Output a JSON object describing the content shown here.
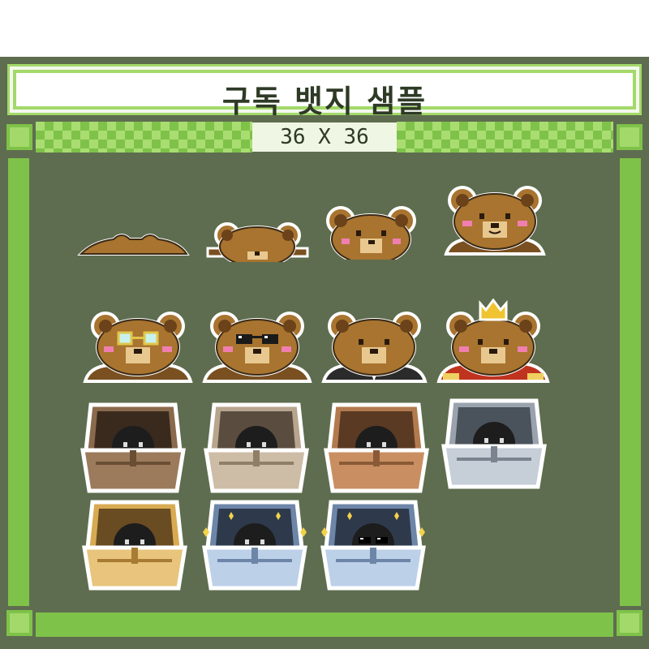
{
  "title": "구독 뱃지 샘플",
  "size_label": "36 X 36",
  "colors": {
    "frame": "#5e6d4f",
    "accent_light": "#a3d96a",
    "accent_dark": "#7fc24a",
    "title_text": "#2e3a26"
  },
  "badges": [
    {
      "kind": "bear",
      "stage": "peek-1"
    },
    {
      "kind": "bear",
      "stage": "peek-2"
    },
    {
      "kind": "bear",
      "stage": "peek-3"
    },
    {
      "kind": "bear",
      "stage": "full"
    },
    {
      "kind": "bear",
      "accessory": "glasses"
    },
    {
      "kind": "bear",
      "accessory": "sunglasses"
    },
    {
      "kind": "bear",
      "accessory": "suit"
    },
    {
      "kind": "bear",
      "accessory": "crown-cape"
    },
    {
      "kind": "chest",
      "color": "dark-brown"
    },
    {
      "kind": "chest",
      "color": "beige"
    },
    {
      "kind": "chest",
      "color": "copper"
    },
    {
      "kind": "chest",
      "color": "silver"
    },
    {
      "kind": "chest",
      "color": "gold"
    },
    {
      "kind": "chest",
      "color": "blue-sparkle"
    },
    {
      "kind": "chest",
      "color": "blue-sparkle-sunglasses"
    }
  ]
}
